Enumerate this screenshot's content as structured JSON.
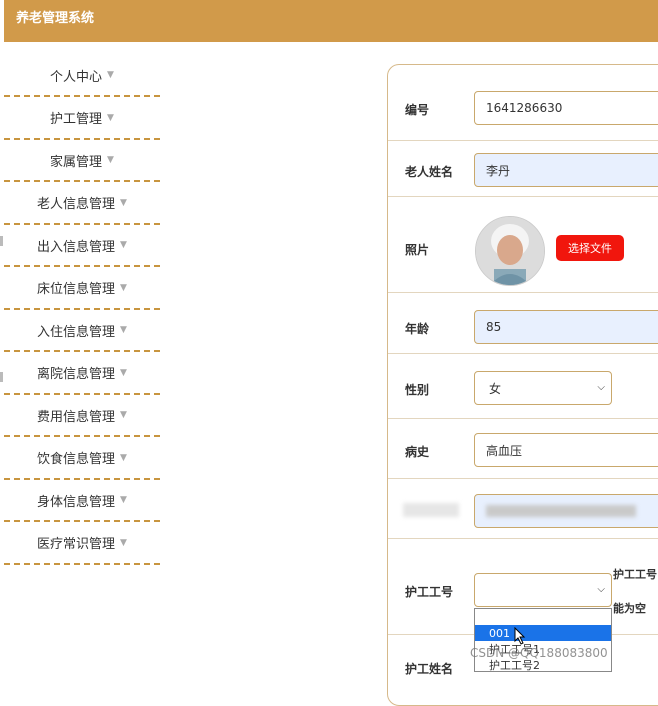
{
  "header": {
    "title": "养老管理系统"
  },
  "sidebar": {
    "items": [
      {
        "label": "个人中心"
      },
      {
        "label": "护工管理"
      },
      {
        "label": "家属管理"
      },
      {
        "label": "老人信息管理"
      },
      {
        "label": "出入信息管理"
      },
      {
        "label": "床位信息管理"
      },
      {
        "label": "入住信息管理"
      },
      {
        "label": "离院信息管理"
      },
      {
        "label": "费用信息管理"
      },
      {
        "label": "饮食信息管理"
      },
      {
        "label": "身体信息管理"
      },
      {
        "label": "医疗常识管理"
      }
    ]
  },
  "form": {
    "id_label": "编号",
    "id_value": "1641286630",
    "name_label": "老人姓名",
    "name_value": "李丹",
    "photo_label": "照片",
    "file_button": "选择文件",
    "age_label": "年龄",
    "age_value": "85",
    "gender_label": "性别",
    "gender_value": "女",
    "history_label": "病史",
    "history_value": "高血压",
    "caregiver_no_label": "护工工号",
    "caregiver_hint_1": "护工工号",
    "caregiver_hint_2": "能为空",
    "caregiver_name_label": "护工姓名",
    "dropdown_options": [
      "001",
      "护工工号1",
      "护工工号2"
    ]
  },
  "watermark": "CSDN @QQ188083800",
  "colors": {
    "header": "#d19a4a",
    "accent": "#c8953f",
    "file_button": "#f1160d",
    "selected_option": "#1a73e8"
  }
}
